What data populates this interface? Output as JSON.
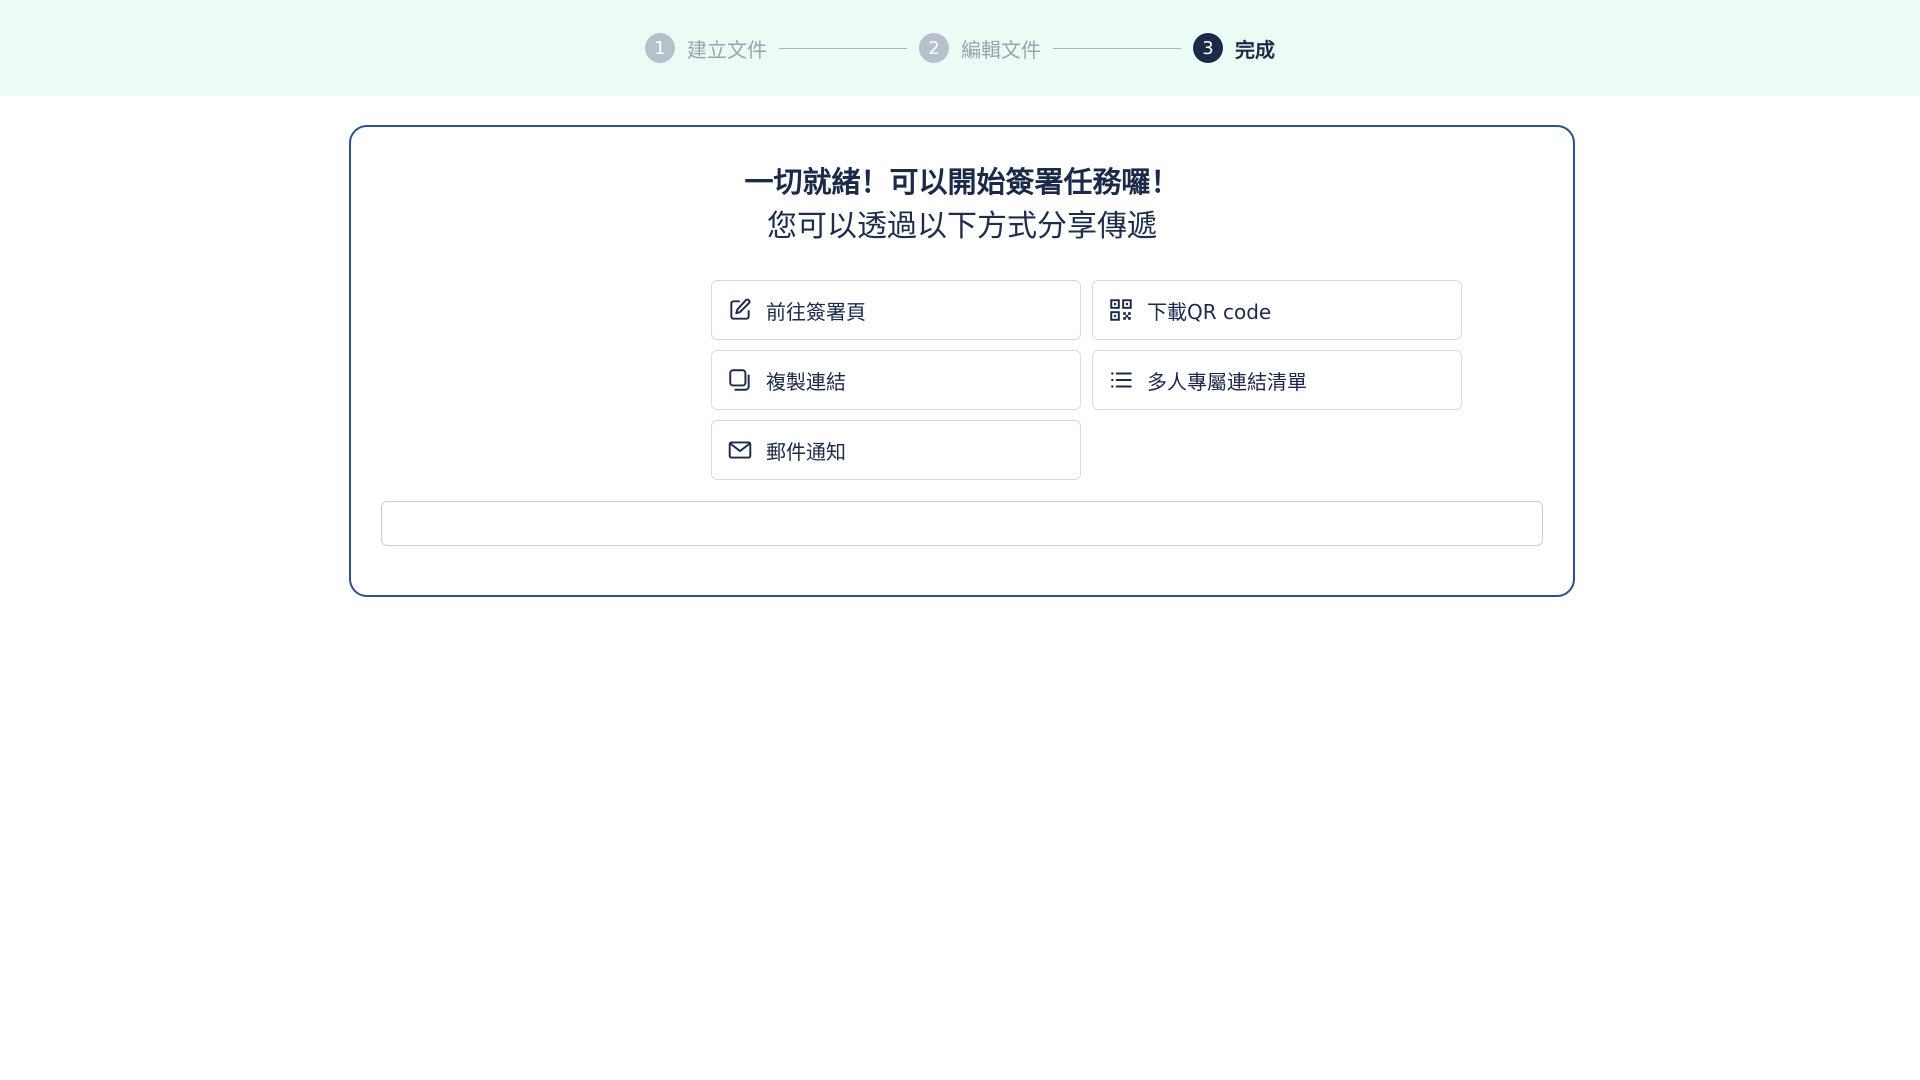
{
  "stepper": {
    "steps": [
      {
        "number": "1",
        "label": "建立文件",
        "state": "inactive"
      },
      {
        "number": "2",
        "label": "編輯文件",
        "state": "inactive"
      },
      {
        "number": "3",
        "label": "完成",
        "state": "active"
      }
    ]
  },
  "card": {
    "headline": "一切就緒！可以開始簽署任務囉！",
    "subline": "您可以透過以下方式分享傳遞"
  },
  "actions": {
    "goto_sign_page": {
      "label": "前往簽署頁",
      "icon": "edit-icon"
    },
    "download_qr": {
      "label": "下載QR code",
      "icon": "qr-code-icon"
    },
    "copy_link": {
      "label": "複製連結",
      "icon": "copy-icon"
    },
    "multi_link_list": {
      "label": "多人專屬連結清單",
      "icon": "list-icon"
    },
    "email_notify": {
      "label": "郵件通知",
      "icon": "mail-icon"
    }
  },
  "link_field": {
    "value": ""
  },
  "colors": {
    "topbar_bg": "#ecfbf4",
    "card_border": "#2f4f8f",
    "primary_text": "#1c2a4a",
    "inactive_step": "#b7c1cc"
  }
}
